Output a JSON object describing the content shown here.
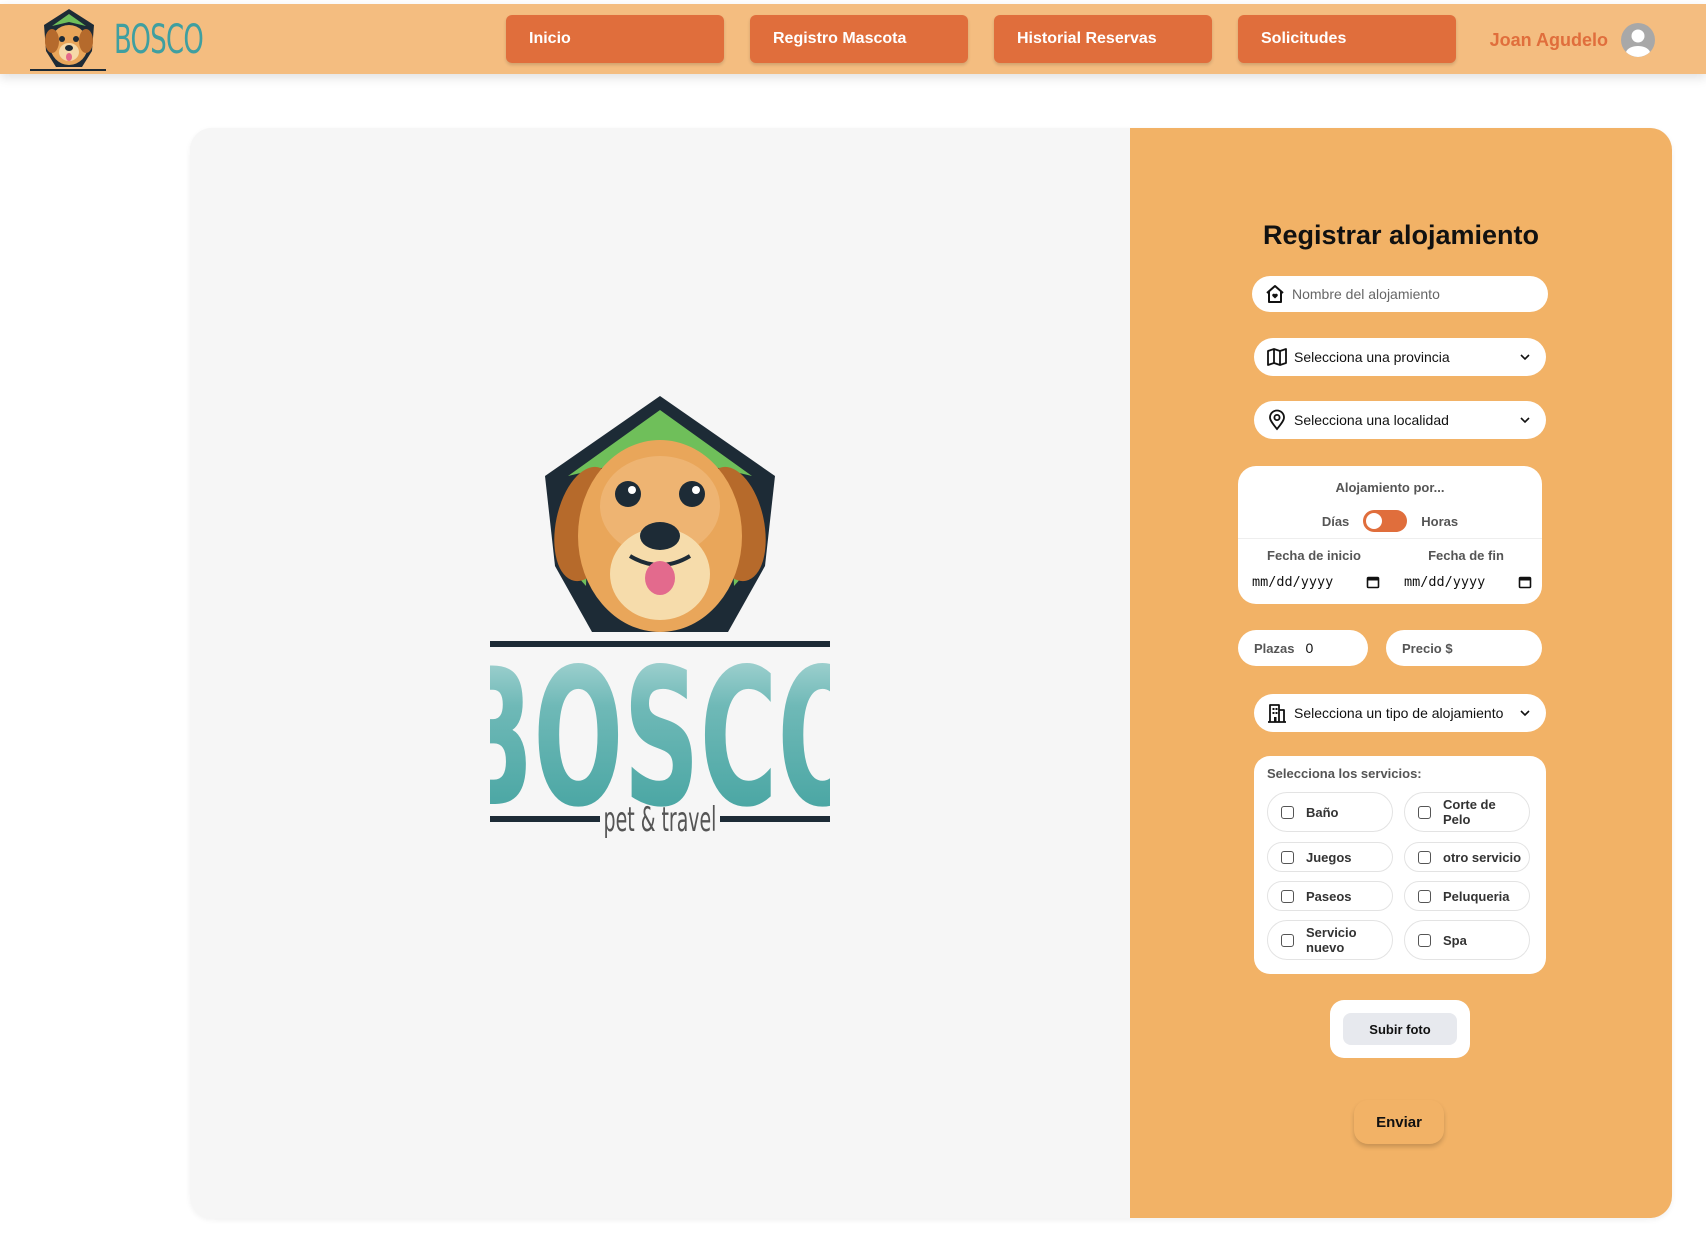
{
  "header": {
    "brand": "BOSCO",
    "nav": [
      "Inicio",
      "Registro Mascota",
      "Historial Reservas",
      "Solicitudes"
    ],
    "user_name": "Joan Agudelo"
  },
  "logo": {
    "main": "BOSCO",
    "tagline": "pet & travel"
  },
  "form": {
    "title": "Registrar alojamiento",
    "name_placeholder": "Nombre del alojamiento",
    "province": "Selecciona una provincia",
    "locality": "Selecciona una localidad",
    "stay_label": "Alojamiento por...",
    "toggle_left": "Días",
    "toggle_right": "Horas",
    "start_label": "Fecha de inicio",
    "end_label": "Fecha de fin",
    "start_value": "mm/dd/yyyy",
    "end_value": "mm/dd/yyyy",
    "plazas_label": "Plazas",
    "plazas_value": "0",
    "price_label": "Precio $",
    "type": "Selecciona un tipo de alojamiento",
    "services_label": "Selecciona los servicios:",
    "services": [
      "Baño",
      "Corte de Pelo",
      "Juegos",
      "otro servicio",
      "Paseos",
      "Peluqueria",
      "Servicio nuevo",
      "Spa"
    ],
    "upload": "Subir foto",
    "submit": "Enviar"
  },
  "colors": {
    "header": "#f4bd80",
    "accent": "#e06e3c",
    "panel": "#f2b266",
    "brand_teal": "#3f9fa0"
  }
}
